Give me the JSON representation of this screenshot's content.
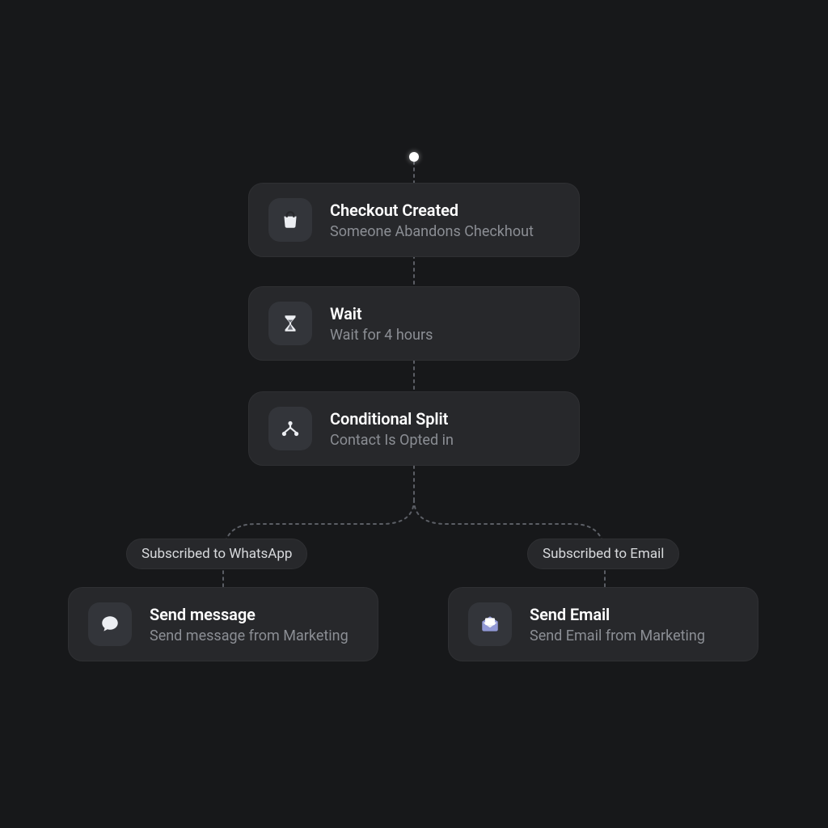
{
  "flow": {
    "trigger": {
      "title": "Checkout Created",
      "subtitle": "Someone Abandons Checkhout"
    },
    "wait": {
      "title": "Wait",
      "subtitle": "Wait for 4 hours"
    },
    "split": {
      "title": "Conditional Split",
      "subtitle": "Contact Is Opted in"
    },
    "branch_left": {
      "label": "Subscribed to WhatsApp",
      "action": {
        "title": "Send message",
        "subtitle": "Send message from Marketing"
      }
    },
    "branch_right": {
      "label": "Subscribed to Email",
      "action": {
        "title": "Send Email",
        "subtitle": "Send Email from Marketing"
      }
    }
  }
}
